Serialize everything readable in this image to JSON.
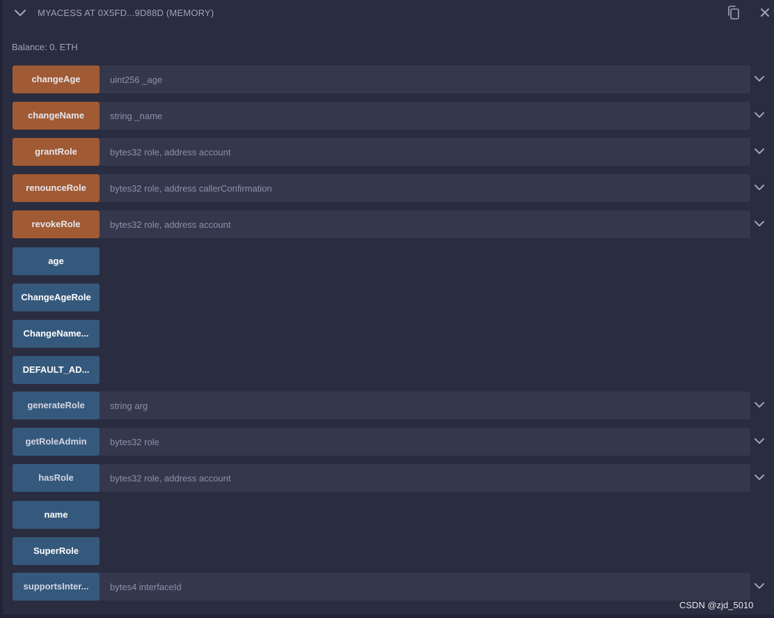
{
  "header": {
    "title": "MYACESS AT 0X5FD...9D88D (MEMORY)"
  },
  "balance": "Balance: 0. ETH",
  "functions": [
    {
      "label": "changeAge",
      "kind": "transact",
      "placeholder": "uint256 _age"
    },
    {
      "label": "changeName",
      "kind": "transact",
      "placeholder": "string _name"
    },
    {
      "label": "grantRole",
      "kind": "transact",
      "placeholder": "bytes32 role, address account"
    },
    {
      "label": "renounceRole",
      "kind": "transact",
      "placeholder": "bytes32 role, address callerConfirmation"
    },
    {
      "label": "revokeRole",
      "kind": "transact",
      "placeholder": "bytes32 role, address account"
    },
    {
      "label": "age",
      "kind": "call"
    },
    {
      "label": "ChangeAgeRole",
      "kind": "call"
    },
    {
      "label": "ChangeName...",
      "kind": "call"
    },
    {
      "label": "DEFAULT_AD...",
      "kind": "call"
    },
    {
      "label": "generateRole",
      "kind": "call",
      "placeholder": "string arg"
    },
    {
      "label": "getRoleAdmin",
      "kind": "call",
      "placeholder": "bytes32 role"
    },
    {
      "label": "hasRole",
      "kind": "call",
      "placeholder": "bytes32 role, address account"
    },
    {
      "label": "name",
      "kind": "call"
    },
    {
      "label": "SuperRole",
      "kind": "call"
    },
    {
      "label": "supportsInter...",
      "kind": "call",
      "placeholder": "bytes4 interfaceId"
    }
  ],
  "icons": {
    "toggle": "chevron-down-icon",
    "copy": "copy-icon",
    "close": "close-icon",
    "expand": "chevron-down-icon"
  },
  "colors": {
    "background": "#2a2c3f",
    "transact_button": "#a05b34",
    "call_button": "#35597c",
    "input_background": "#35374d",
    "muted_text": "#a2a3bd"
  },
  "watermark": "CSDN @zjd_5010"
}
